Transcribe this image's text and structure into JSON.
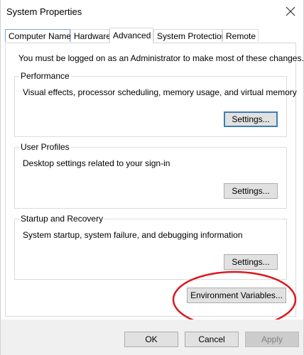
{
  "window": {
    "title": "System Properties",
    "close_icon": "close-icon"
  },
  "tabs": [
    {
      "label": "Computer Name",
      "active": false
    },
    {
      "label": "Hardware",
      "active": false
    },
    {
      "label": "Advanced",
      "active": true
    },
    {
      "label": "System Protection",
      "active": false
    },
    {
      "label": "Remote",
      "active": false
    }
  ],
  "advanced": {
    "notice": "You must be logged on as an Administrator to make most of these changes.",
    "performance": {
      "legend": "Performance",
      "description": "Visual effects, processor scheduling, memory usage, and virtual memory",
      "button": "Settings..."
    },
    "user_profiles": {
      "legend": "User Profiles",
      "description": "Desktop settings related to your sign-in",
      "button": "Settings..."
    },
    "startup_recovery": {
      "legend": "Startup and Recovery",
      "description": "System startup, system failure, and debugging information",
      "button": "Settings..."
    },
    "environment_button": "Environment Variables..."
  },
  "footer": {
    "ok": "OK",
    "cancel": "Cancel",
    "apply": "Apply"
  },
  "colors": {
    "highlight_annotation": "#d9181f",
    "default_button_border": "#3c7fb1",
    "button_face": "#e1e1e1",
    "footer_background": "#f0f0f0"
  }
}
